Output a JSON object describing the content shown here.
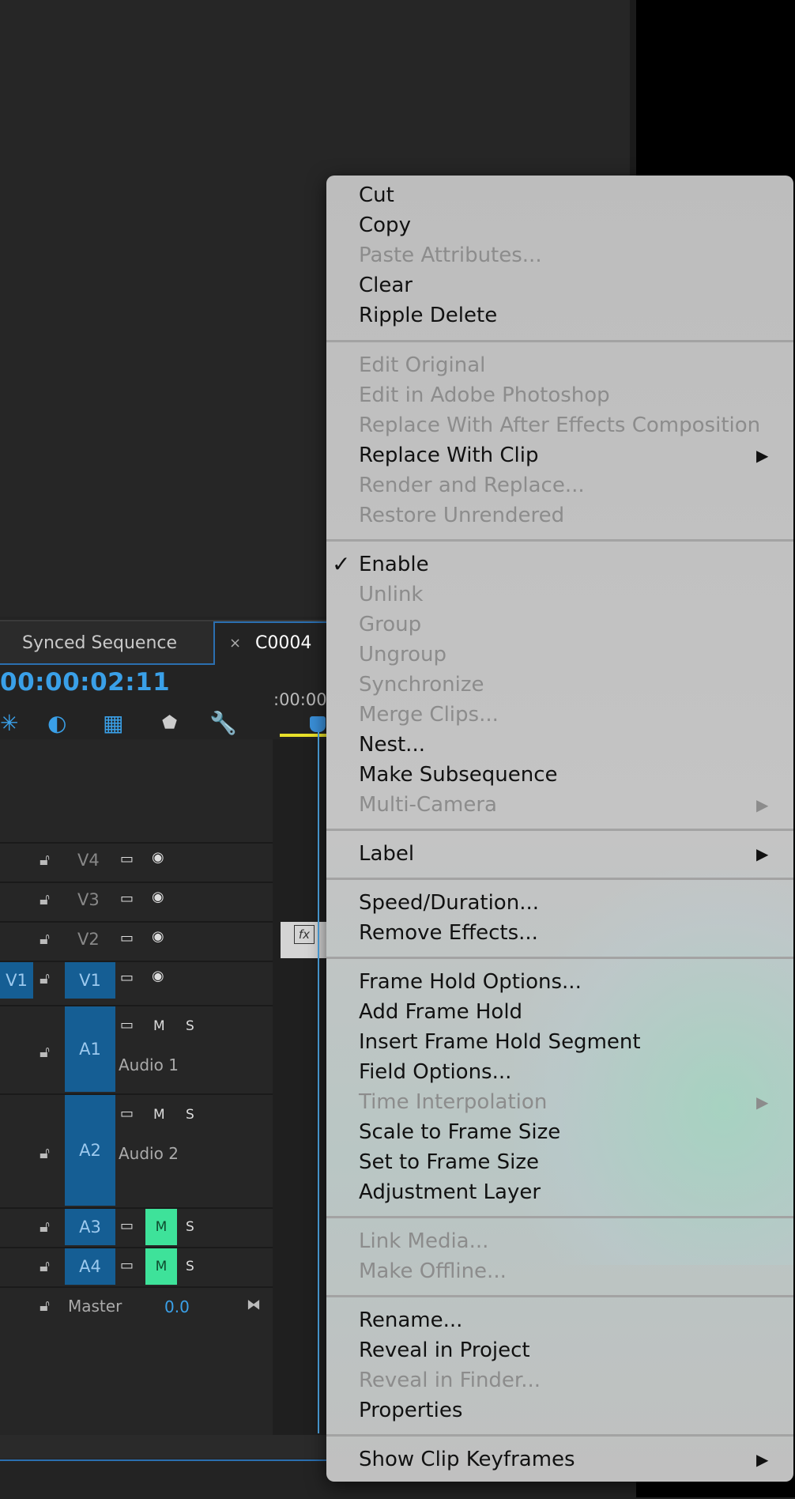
{
  "timeline": {
    "tab_synced": "Synced Sequence",
    "tab_close": "×",
    "tab_active": "C0004",
    "timecode": "00:00:02:11",
    "ruler_start": ":00:00",
    "tracks": {
      "v4": "V4",
      "v3": "V3",
      "v2": "V2",
      "v1": "V1",
      "v1_source": "V1",
      "a1": "A1",
      "a1_name": "Audio 1",
      "a2": "A2",
      "a2_name": "Audio 2",
      "a3": "A3",
      "a4": "A4",
      "master": "Master",
      "master_value": "0.0",
      "m": "M",
      "s": "S"
    }
  },
  "menu": {
    "cut": "Cut",
    "copy": "Copy",
    "paste_attributes": "Paste Attributes...",
    "clear": "Clear",
    "ripple_delete": "Ripple Delete",
    "edit_original": "Edit Original",
    "edit_photoshop": "Edit in Adobe Photoshop",
    "replace_ae": "Replace With After Effects Composition",
    "replace_clip": "Replace With Clip",
    "render_replace": "Render and Replace...",
    "restore_unrendered": "Restore Unrendered",
    "enable": "Enable",
    "enable_check": "✓",
    "unlink": "Unlink",
    "group": "Group",
    "ungroup": "Ungroup",
    "synchronize": "Synchronize",
    "merge_clips": "Merge Clips...",
    "nest": "Nest...",
    "make_subsequence": "Make Subsequence",
    "multi_camera": "Multi-Camera",
    "label": "Label",
    "speed_duration": "Speed/Duration...",
    "remove_effects": "Remove Effects...",
    "frame_hold_options": "Frame Hold Options...",
    "add_frame_hold": "Add Frame Hold",
    "insert_frame_hold_segment": "Insert Frame Hold Segment",
    "field_options": "Field Options...",
    "time_interpolation": "Time Interpolation",
    "scale_to_frame_size": "Scale to Frame Size",
    "set_to_frame_size": "Set to Frame Size",
    "adjustment_layer": "Adjustment Layer",
    "link_media": "Link Media...",
    "make_offline": "Make Offline...",
    "rename": "Rename...",
    "reveal_project": "Reveal in Project",
    "reveal_finder": "Reveal in Finder...",
    "properties": "Properties",
    "show_clip_keyframes": "Show Clip Keyframes",
    "submenu_arrow": "▶"
  },
  "colors": {
    "accent_blue": "#3aa0e8",
    "track_target_blue": "#155e94",
    "mute_green": "#3ee29a",
    "menu_bg": "#c2c2c2",
    "menu_disabled": "#8c8c8c"
  }
}
